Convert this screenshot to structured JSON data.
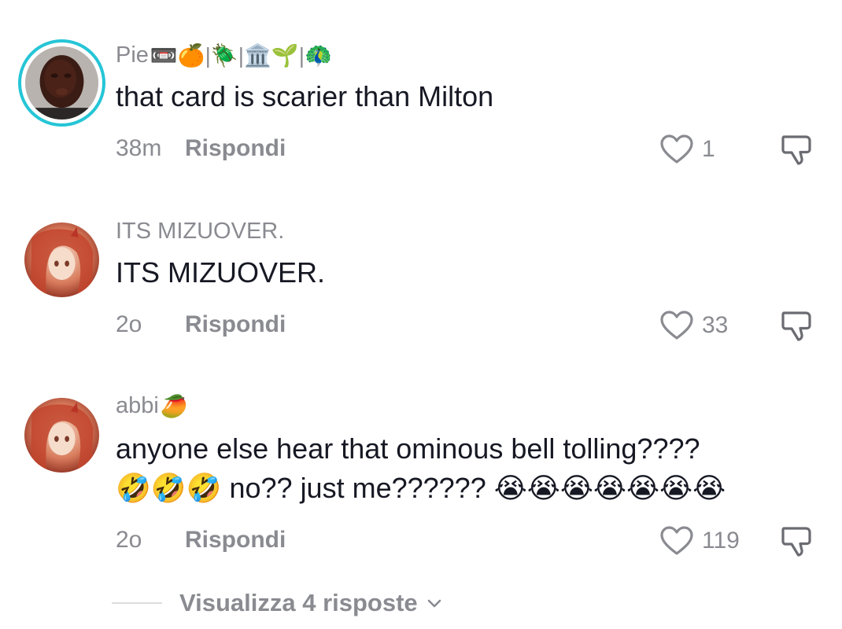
{
  "comments": [
    {
      "username": "Pie",
      "username_emojis": "📼🍊|🪲|🏛️🌱|🦚",
      "text": "that card is scarier than Milton",
      "time": "38m",
      "reply_label": "Rispondi",
      "likes": "1",
      "avatar_ring": true
    },
    {
      "username": "ITS MIZUOVER.",
      "username_emojis": "",
      "text": "ITS MIZUOVER.",
      "time": "2o",
      "reply_label": "Rispondi",
      "likes": "33",
      "avatar_ring": false
    },
    {
      "username": "abbi",
      "username_emojis": "🥭",
      "text_line1": "anyone else hear that ominous bell tolling????",
      "text_line2": "🤣🤣🤣 no?? just me?????? 😭😭😭😭😭😭😭",
      "time": "2o",
      "reply_label": "Rispondi",
      "likes": "119",
      "avatar_ring": false
    }
  ],
  "view_replies": {
    "label": "Visualizza 4 risposte"
  },
  "colors": {
    "ring": "#25c5d6",
    "secondary_text": "#8a8b91",
    "primary_text": "#161823"
  },
  "icons": [
    "heart-icon",
    "dislike-icon",
    "chevron-down-icon"
  ]
}
